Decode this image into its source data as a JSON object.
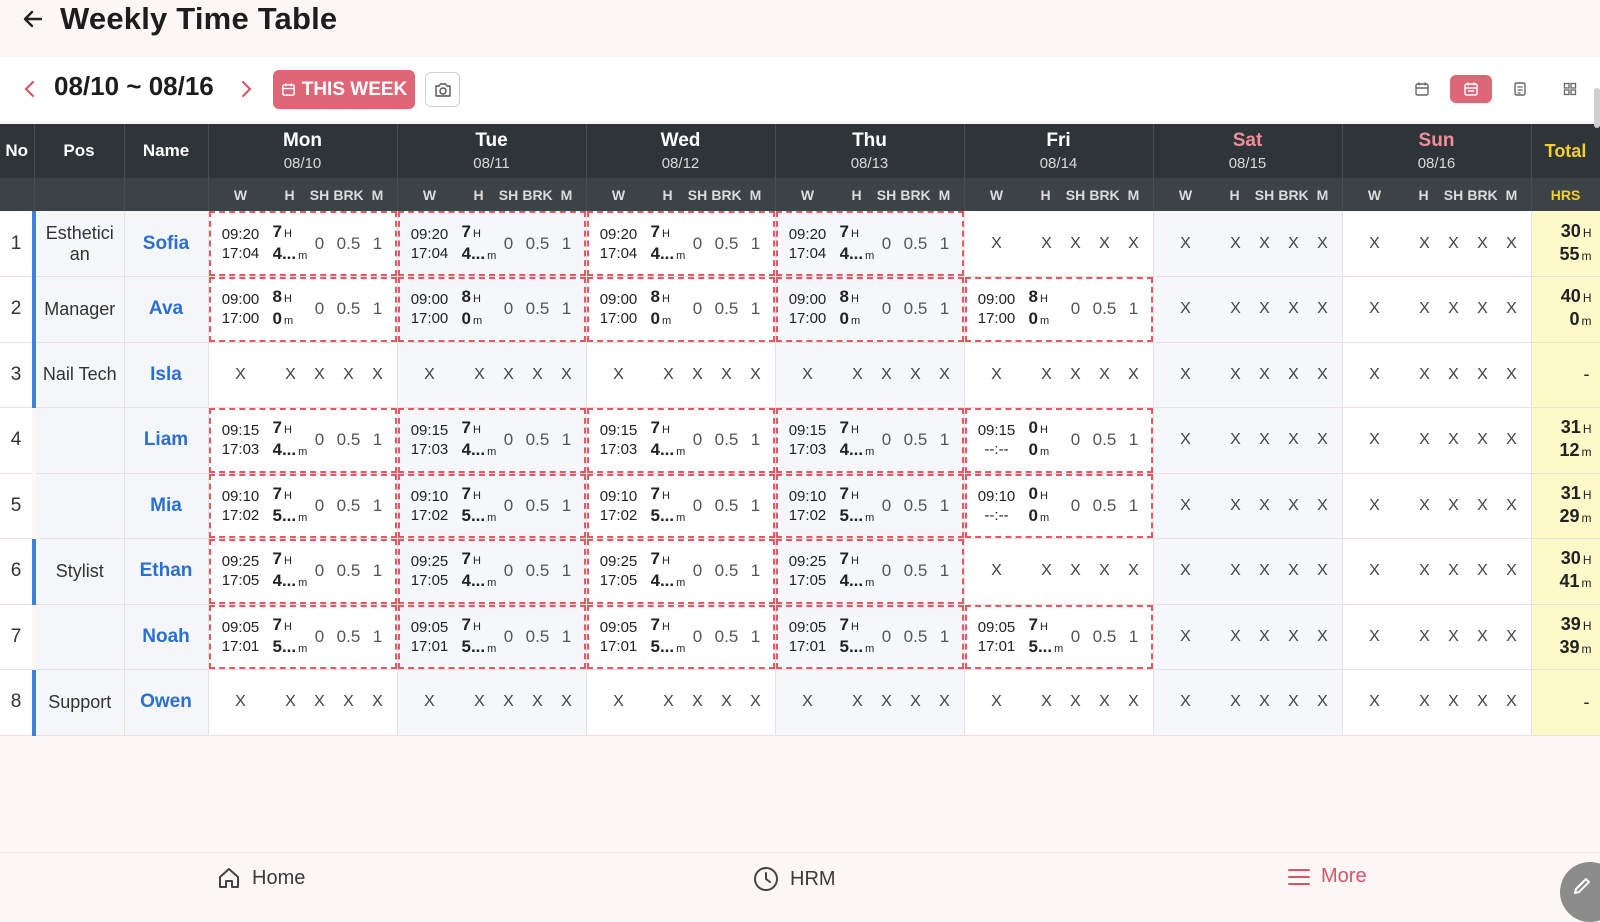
{
  "header": {
    "title": "Weekly Time Table"
  },
  "toolbar": {
    "range": "08/10 ~ 08/16",
    "this_week_label": "THIS WEEK"
  },
  "table": {
    "col_no": "No",
    "col_pos": "Pos",
    "col_name": "Name",
    "col_total": "Total",
    "col_hrs": "HRS",
    "sub_headers": {
      "w": "W",
      "h": "H",
      "sh": "SH",
      "brk": "BRK",
      "m": "M"
    },
    "days": [
      {
        "day": "Mon",
        "date": "08/10",
        "weekend": false
      },
      {
        "day": "Tue",
        "date": "08/11",
        "weekend": false
      },
      {
        "day": "Wed",
        "date": "08/12",
        "weekend": false
      },
      {
        "day": "Thu",
        "date": "08/13",
        "weekend": false
      },
      {
        "day": "Fri",
        "date": "08/14",
        "weekend": false
      },
      {
        "day": "Sat",
        "date": "08/15",
        "weekend": true
      },
      {
        "day": "Sun",
        "date": "08/16",
        "weekend": true
      }
    ],
    "hour_unit": "H",
    "minute_unit": "m",
    "empty_mark": "X",
    "rows": [
      {
        "no": "1",
        "pos": "Esthetici an",
        "pos_bar": true,
        "name": "Sofia",
        "cells": [
          {
            "in": "09:20",
            "out": "17:04",
            "h": "7",
            "m": "4...",
            "sh": "0",
            "brk": "0.5",
            "mm": "1"
          },
          {
            "in": "09:20",
            "out": "17:04",
            "h": "7",
            "m": "4...",
            "sh": "0",
            "brk": "0.5",
            "mm": "1"
          },
          {
            "in": "09:20",
            "out": "17:04",
            "h": "7",
            "m": "4...",
            "sh": "0",
            "brk": "0.5",
            "mm": "1"
          },
          {
            "in": "09:20",
            "out": "17:04",
            "h": "7",
            "m": "4...",
            "sh": "0",
            "brk": "0.5",
            "mm": "1"
          },
          null,
          null,
          null
        ],
        "total_h": "30",
        "total_m": "55"
      },
      {
        "no": "2",
        "pos": "Manager",
        "pos_bar": true,
        "name": "Ava",
        "cells": [
          {
            "in": "09:00",
            "out": "17:00",
            "h": "8",
            "m": "0",
            "sh": "0",
            "brk": "0.5",
            "mm": "1"
          },
          {
            "in": "09:00",
            "out": "17:00",
            "h": "8",
            "m": "0",
            "sh": "0",
            "brk": "0.5",
            "mm": "1"
          },
          {
            "in": "09:00",
            "out": "17:00",
            "h": "8",
            "m": "0",
            "sh": "0",
            "brk": "0.5",
            "mm": "1"
          },
          {
            "in": "09:00",
            "out": "17:00",
            "h": "8",
            "m": "0",
            "sh": "0",
            "brk": "0.5",
            "mm": "1"
          },
          {
            "in": "09:00",
            "out": "17:00",
            "h": "8",
            "m": "0",
            "sh": "0",
            "brk": "0.5",
            "mm": "1"
          },
          null,
          null
        ],
        "total_h": "40",
        "total_m": "0"
      },
      {
        "no": "3",
        "pos": "Nail Tech",
        "pos_bar": true,
        "name": "Isla",
        "cells": [
          null,
          null,
          null,
          null,
          null,
          null,
          null
        ],
        "total_dash": "-"
      },
      {
        "no": "4",
        "pos": "",
        "pos_bar": false,
        "name": "Liam",
        "cells": [
          {
            "in": "09:15",
            "out": "17:03",
            "h": "7",
            "m": "4...",
            "sh": "0",
            "brk": "0.5",
            "mm": "1"
          },
          {
            "in": "09:15",
            "out": "17:03",
            "h": "7",
            "m": "4...",
            "sh": "0",
            "brk": "0.5",
            "mm": "1"
          },
          {
            "in": "09:15",
            "out": "17:03",
            "h": "7",
            "m": "4...",
            "sh": "0",
            "brk": "0.5",
            "mm": "1"
          },
          {
            "in": "09:15",
            "out": "17:03",
            "h": "7",
            "m": "4...",
            "sh": "0",
            "brk": "0.5",
            "mm": "1"
          },
          {
            "in": "09:15",
            "out": "--:--",
            "h": "0",
            "m": "0",
            "sh": "0",
            "brk": "0.5",
            "mm": "1"
          },
          null,
          null
        ],
        "total_h": "31",
        "total_m": "12"
      },
      {
        "no": "5",
        "pos": "",
        "pos_bar": false,
        "name": "Mia",
        "cells": [
          {
            "in": "09:10",
            "out": "17:02",
            "h": "7",
            "m": "5...",
            "sh": "0",
            "brk": "0.5",
            "mm": "1"
          },
          {
            "in": "09:10",
            "out": "17:02",
            "h": "7",
            "m": "5...",
            "sh": "0",
            "brk": "0.5",
            "mm": "1"
          },
          {
            "in": "09:10",
            "out": "17:02",
            "h": "7",
            "m": "5...",
            "sh": "0",
            "brk": "0.5",
            "mm": "1"
          },
          {
            "in": "09:10",
            "out": "17:02",
            "h": "7",
            "m": "5...",
            "sh": "0",
            "brk": "0.5",
            "mm": "1"
          },
          {
            "in": "09:10",
            "out": "--:--",
            "h": "0",
            "m": "0",
            "sh": "0",
            "brk": "0.5",
            "mm": "1"
          },
          null,
          null
        ],
        "total_h": "31",
        "total_m": "29"
      },
      {
        "no": "6",
        "pos": "Stylist",
        "pos_bar": true,
        "name": "Ethan",
        "cells": [
          {
            "in": "09:25",
            "out": "17:05",
            "h": "7",
            "m": "4...",
            "sh": "0",
            "brk": "0.5",
            "mm": "1"
          },
          {
            "in": "09:25",
            "out": "17:05",
            "h": "7",
            "m": "4...",
            "sh": "0",
            "brk": "0.5",
            "mm": "1"
          },
          {
            "in": "09:25",
            "out": "17:05",
            "h": "7",
            "m": "4...",
            "sh": "0",
            "brk": "0.5",
            "mm": "1"
          },
          {
            "in": "09:25",
            "out": "17:05",
            "h": "7",
            "m": "4...",
            "sh": "0",
            "brk": "0.5",
            "mm": "1"
          },
          null,
          null,
          null
        ],
        "total_h": "30",
        "total_m": "41"
      },
      {
        "no": "7",
        "pos": "",
        "pos_bar": false,
        "name": "Noah",
        "cells": [
          {
            "in": "09:05",
            "out": "17:01",
            "h": "7",
            "m": "5...",
            "sh": "0",
            "brk": "0.5",
            "mm": "1"
          },
          {
            "in": "09:05",
            "out": "17:01",
            "h": "7",
            "m": "5...",
            "sh": "0",
            "brk": "0.5",
            "mm": "1"
          },
          {
            "in": "09:05",
            "out": "17:01",
            "h": "7",
            "m": "5...",
            "sh": "0",
            "brk": "0.5",
            "mm": "1"
          },
          {
            "in": "09:05",
            "out": "17:01",
            "h": "7",
            "m": "5...",
            "sh": "0",
            "brk": "0.5",
            "mm": "1"
          },
          {
            "in": "09:05",
            "out": "17:01",
            "h": "7",
            "m": "5...",
            "sh": "0",
            "brk": "0.5",
            "mm": "1"
          },
          null,
          null
        ],
        "total_h": "39",
        "total_m": "39"
      },
      {
        "no": "8",
        "pos": "Support",
        "pos_bar": true,
        "name": "Owen",
        "cells": [
          null,
          null,
          null,
          null,
          null,
          null,
          null
        ],
        "total_dash": "-"
      }
    ]
  },
  "bottom_nav": {
    "home": "Home",
    "hrm": "HRM",
    "more": "More"
  },
  "colors": {
    "accent": "#df6677",
    "header_dark": "#2f3438",
    "total_bg": "#fdf9c8",
    "name_blue": "#2b6fd1",
    "dashed": "#e05a64"
  },
  "icons": [
    "back-arrow-icon",
    "chevron-left-icon",
    "chevron-right-icon",
    "calendar-icon",
    "camera-icon",
    "calendar-day-icon",
    "calendar-week-icon",
    "calendar-month-icon",
    "grid-view-icon",
    "home-icon",
    "clock-icon",
    "menu-icon",
    "pencil-icon"
  ]
}
